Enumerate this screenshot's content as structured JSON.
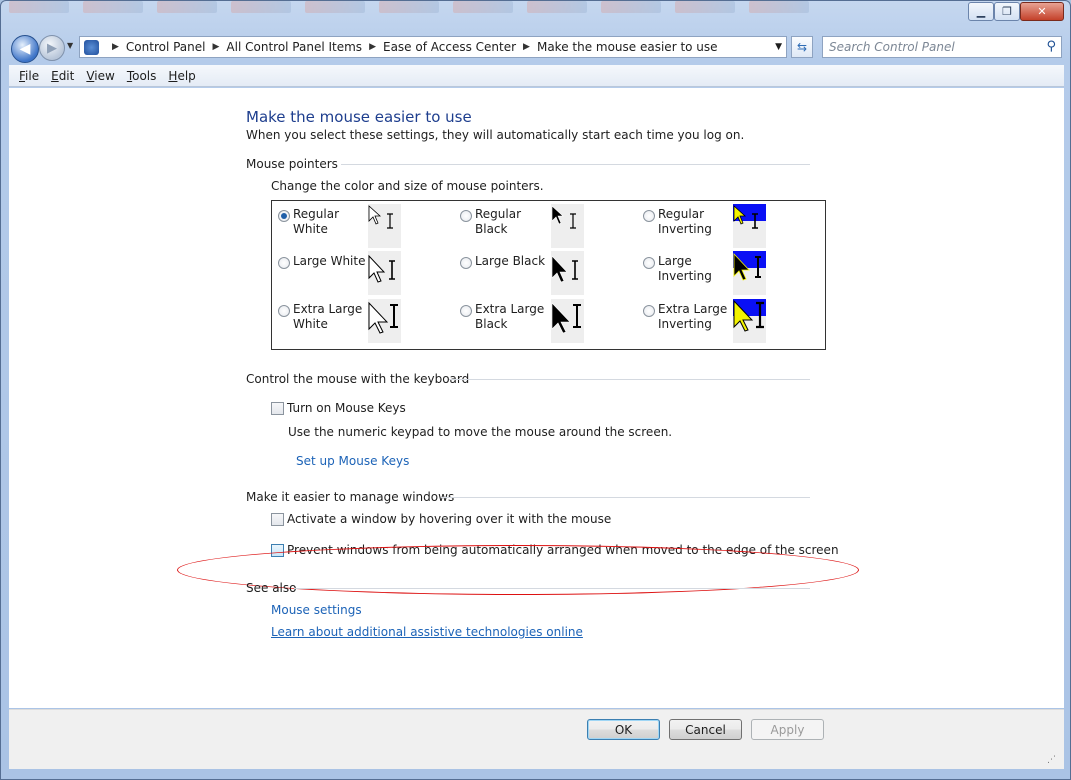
{
  "address": {
    "crumbs": [
      "Control Panel",
      "All Control Panel Items",
      "Ease of Access Center",
      "Make the mouse easier to use"
    ]
  },
  "search": {
    "placeholder": "Search Control Panel"
  },
  "menu": [
    "File",
    "Edit",
    "View",
    "Tools",
    "Help"
  ],
  "page": {
    "title": "Make the mouse easier to use",
    "subtitle": "When you select these settings, they will automatically start each time you log on."
  },
  "pointers": {
    "heading": "Mouse pointers",
    "desc": "Change the color and size of mouse pointers.",
    "options": [
      {
        "label": "Regular White",
        "selected": true
      },
      {
        "label": "Regular Black",
        "selected": false
      },
      {
        "label": "Regular Inverting",
        "selected": false
      },
      {
        "label": "Large White",
        "selected": false
      },
      {
        "label": "Large Black",
        "selected": false
      },
      {
        "label": "Large Inverting",
        "selected": false
      },
      {
        "label": "Extra Large White",
        "selected": false
      },
      {
        "label": "Extra Large Black",
        "selected": false
      },
      {
        "label": "Extra Large Inverting",
        "selected": false
      }
    ]
  },
  "keyboard": {
    "heading": "Control the mouse with the keyboard",
    "mousekeys_label": "Turn on Mouse Keys",
    "mousekeys_desc": "Use the numeric keypad to move the mouse around the screen.",
    "setup_link": "Set up Mouse Keys"
  },
  "windows": {
    "heading": "Make it easier to manage windows",
    "hover_label": "Activate a window by hovering over it with the mouse",
    "prevent_label": "Prevent windows from being automatically arranged when moved to the edge of the screen"
  },
  "see_also": {
    "heading": "See also",
    "mouse_settings": "Mouse settings",
    "learn_more": "Learn about additional assistive technologies online"
  },
  "buttons": {
    "ok": "OK",
    "cancel": "Cancel",
    "apply": "Apply"
  },
  "colors": {
    "link": "#1c63b7",
    "title": "#1e3e8e",
    "highlight_oval": "#dd1111"
  }
}
